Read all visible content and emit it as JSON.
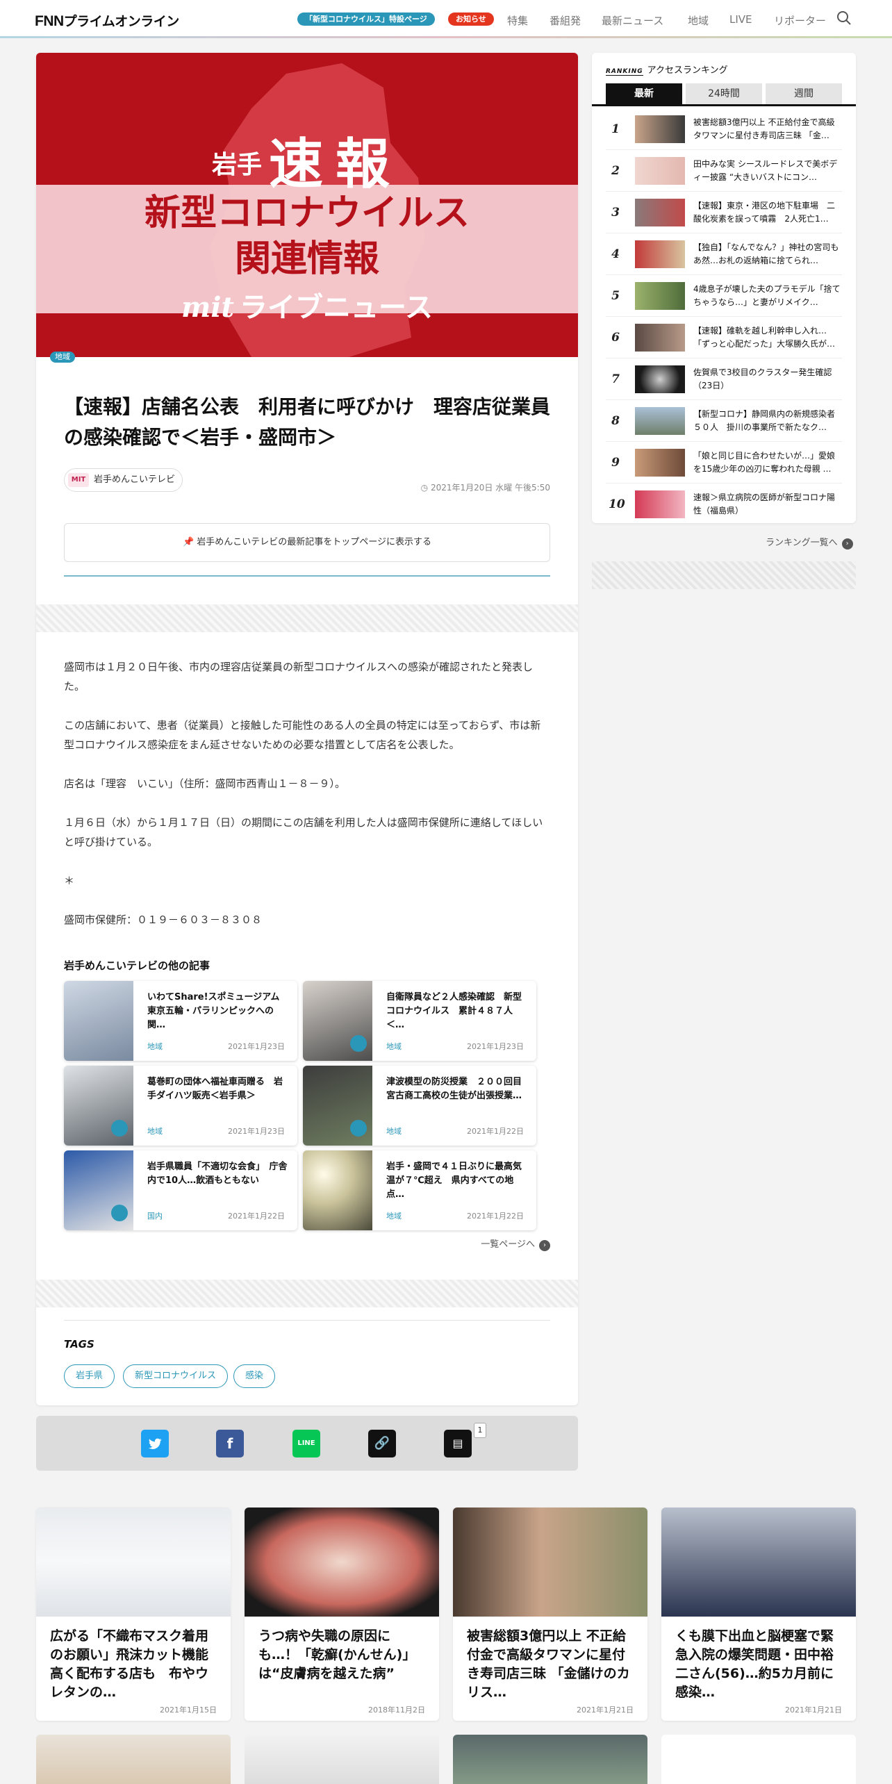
{
  "header": {
    "logo_prefix": "FNN",
    "logo_name": "プライムオンライン",
    "special_pill": "「新型コロナウイルス」特設ページ",
    "notice_pill": "お知らせ",
    "nav": [
      "特集",
      "番組発",
      "最新ニュース",
      "地域",
      "LIVE",
      "リポーター"
    ]
  },
  "hero": {
    "pref": "岩手",
    "flash": "速報",
    "line1": "新型コロナウイルス",
    "line2": "関連情報",
    "brand": "mit",
    "brand_suffix": "ライブニュース"
  },
  "article": {
    "area_tag": "地域",
    "title": "【速報】店舗名公表　利用者に呼びかけ　理容店従業員の感染確認で＜岩手・盛岡市＞",
    "source_logo": "MIT",
    "source": "岩手めんこいテレビ",
    "date": "2021年1月20日 水曜 午後5:50",
    "follow_button": "岩手めんこいテレビの最新記事をトップページに表示する",
    "paragraphs": [
      "盛岡市は１月２０日午後、市内の理容店従業員の新型コロナウイルスへの感染が確認されたと発表した。",
      "この店舗において、患者（従業員）と接触した可能性のある人の全員の特定には至っておらず、市は新型コロナウイルス感染症をまん延させないための必要な措置として店名を公表した。",
      "店名は「理容　いこい」（住所：盛岡市西青山１－８－９）。",
      "１月６日（水）から１月１７日（日）の期間にこの店舗を利用した人は盛岡市保健所に連絡してほしいと呼び掛けている。",
      "＊",
      "盛岡市保健所：０１９－６０３－８３０８"
    ]
  },
  "other_articles": {
    "heading": "岩手めんこいテレビの他の記事",
    "items": [
      {
        "title": "いわてShare!スポミュージアム　東京五輪・パラリンピックへの関…",
        "category": "地域",
        "date": "2021年1月23日"
      },
      {
        "title": "自衛隊員など２人感染確認　新型コロナウイルス　累計４８７人＜…",
        "category": "地域",
        "date": "2021年1月23日"
      },
      {
        "title": "葛巻町の団体へ福祉車両贈る　岩手ダイハツ販売＜岩手県＞",
        "category": "地域",
        "date": "2021年1月23日"
      },
      {
        "title": "津波模型の防災授業　２００回目　宮古商工高校の生徒が出張授業…",
        "category": "地域",
        "date": "2021年1月22日"
      },
      {
        "title": "岩手県職員「不適切な会食」　庁舎内で10人…飲酒もともない",
        "category": "国内",
        "date": "2021年1月22日"
      },
      {
        "title": "岩手・盛岡で４１日ぶりに最高気温が７℃超え　県内すべての地点…",
        "category": "地域",
        "date": "2021年1月22日"
      }
    ],
    "more": "一覧ページへ"
  },
  "tags": {
    "heading": "TAGS",
    "items": [
      "岩手県",
      "新型コロナウイルス",
      "感染"
    ]
  },
  "share": {
    "comment_count": "1"
  },
  "ranking": {
    "logo": "RANKING",
    "heading": "アクセスランキング",
    "tabs": [
      "最新",
      "24時間",
      "週間"
    ],
    "items": [
      {
        "rank": "1",
        "title": "被害総額3億円以上 不正給付金で高級タワマンに星付き寿司店三昧 「金…"
      },
      {
        "rank": "2",
        "title": "田中みな実 シースルードレスで美ボディー披露 “大きいバストにコン…"
      },
      {
        "rank": "3",
        "title": "【速報】東京・港区の地下駐車場　二酸化炭素を誤って噴霧　2人死亡1…"
      },
      {
        "rank": "4",
        "title": "【独自】「なんでなん？」神社の宮司もあ然…お札の返納箱に捨てられ…"
      },
      {
        "rank": "5",
        "title": "4歳息子が壊した夫のプラモデル「捨てちゃうなら…」と妻がリメイク…"
      },
      {
        "rank": "6",
        "title": "【速報】碓軌を越し利幹申し入れ…「ずっと心配だった」大塚勝久氏が…"
      },
      {
        "rank": "7",
        "title": "佐賀県で3校目のクラスター発生確認（23日）"
      },
      {
        "rank": "8",
        "title": "【新型コロナ】静岡県内の新規感染者５０人　掛川の事業所で新たなク…"
      },
      {
        "rank": "9",
        "title": "「娘と同じ目に合わせたいが…」愛娘を15歳少年の凶刃に奪われた母親 …"
      },
      {
        "rank": "10",
        "title": "速報＞県立病院の医師が新型コロナ陽性（福島県）"
      }
    ],
    "more": "ランキング一覧へ"
  },
  "bottom_cards": [
    {
      "title": "広がる「不織布マスク着用のお願い」飛沫カット機能高く配布する店も　布やウレタンの…",
      "date": "2021年1月15日"
    },
    {
      "title": "うつ病や失職の原因にも…！「乾癬(かんせん)」は“皮膚病を越えた病”",
      "date": "2018年11月2日"
    },
    {
      "title": "被害総額3億円以上 不正給付金で高級タワマンに星付き寿司店三昧 「金儲けのカリス…",
      "date": "2021年1月21日"
    },
    {
      "title": "くも膜下出血と脳梗塞で緊急入院の爆笑問題・田中裕二さん(56)…約5カ月前に感染…",
      "date": "2021年1月21日"
    }
  ]
}
